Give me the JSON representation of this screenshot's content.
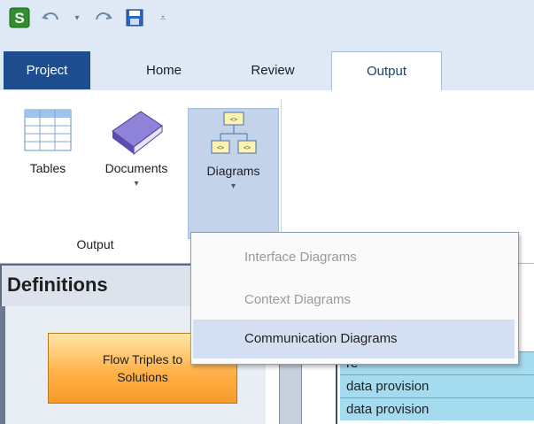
{
  "app": {
    "logo_letter": "S",
    "quick_access": {
      "undo_icon": "undo-icon",
      "redo_icon": "redo-icon",
      "save_icon": "save-icon",
      "customize_icon": "customize-toolbar-icon"
    }
  },
  "tabs": [
    {
      "label": "Project"
    },
    {
      "label": "Home"
    },
    {
      "label": "Review"
    },
    {
      "label": "Output"
    }
  ],
  "ribbon": {
    "buttons": [
      {
        "label": "Tables",
        "icon": "table-icon"
      },
      {
        "label": "Documents",
        "icon": "book-icon",
        "arrow": "▾"
      },
      {
        "label": "Diagrams",
        "icon": "diagram-icon",
        "arrow": "▾"
      }
    ],
    "group_label": "Output"
  },
  "left_pane": {
    "title": "Definitions",
    "button_label": "Flow Triples to\nSolutions"
  },
  "grid": {
    "cells": [
      "re",
      "data provision",
      "data provision"
    ]
  },
  "menu": {
    "items": [
      {
        "label": "Interface Diagrams",
        "state": "disabled"
      },
      {
        "label": "Context Diagrams",
        "state": "disabled"
      },
      {
        "label": "Communication Diagrams",
        "state": "highlighted"
      }
    ]
  },
  "colors": {
    "accent": "#1d4d8f",
    "ribbon_bg": "#dfe8f5",
    "highlight": "#d4e0f1",
    "cell_bg": "#a5dbef",
    "button_orange": "#ffb24a"
  }
}
